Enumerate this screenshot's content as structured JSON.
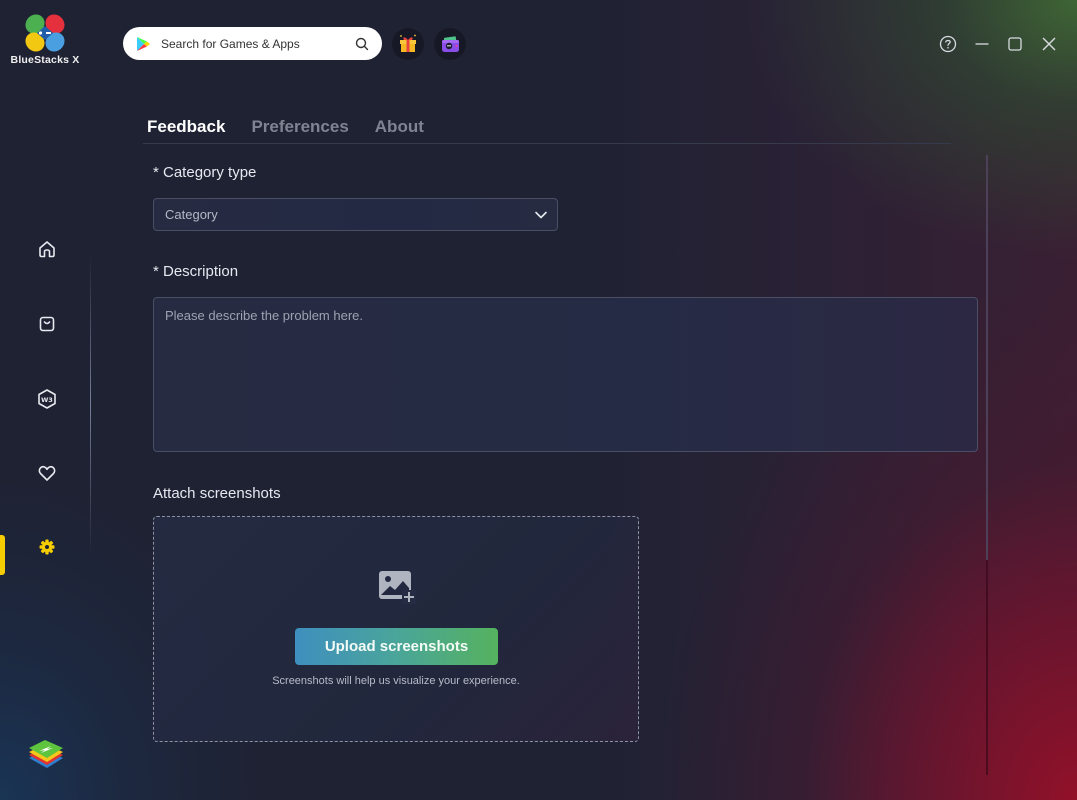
{
  "app": {
    "name": "BlueStacks X"
  },
  "header": {
    "search_placeholder": "Search for Games & Apps",
    "icons": [
      "google-play-icon",
      "search-icon",
      "gift-icon",
      "wallet-icon"
    ],
    "window_controls": [
      "help-icon",
      "minimize-icon",
      "maximize-icon",
      "close-icon"
    ]
  },
  "sidebar": {
    "items": [
      {
        "name": "home",
        "icon": "home-icon",
        "active": false
      },
      {
        "name": "store",
        "icon": "shopping-bag-icon",
        "active": false
      },
      {
        "name": "web3",
        "icon": "w3-hexagon-icon",
        "active": false,
        "glyph": "W3"
      },
      {
        "name": "favorites",
        "icon": "heart-icon",
        "active": false
      },
      {
        "name": "settings",
        "icon": "gear-icon",
        "active": true
      }
    ],
    "active_color": "#f6cd00"
  },
  "tabs": [
    {
      "label": "Feedback",
      "active": true
    },
    {
      "label": "Preferences",
      "active": false
    },
    {
      "label": "About",
      "active": false
    }
  ],
  "form": {
    "category_label": "* Category type",
    "category_value": "Category",
    "description_label": "* Description",
    "description_placeholder": "Please describe the problem here.",
    "description_value": "",
    "attach_label": "Attach screenshots",
    "upload_button": "Upload screenshots",
    "upload_hint": "Screenshots will help us visualize your experience."
  },
  "colors": {
    "background": "#1f2233",
    "upload_gradient_start": "#3f8fbf",
    "upload_gradient_end": "#55b25e",
    "accent_yellow": "#f6cd00"
  }
}
